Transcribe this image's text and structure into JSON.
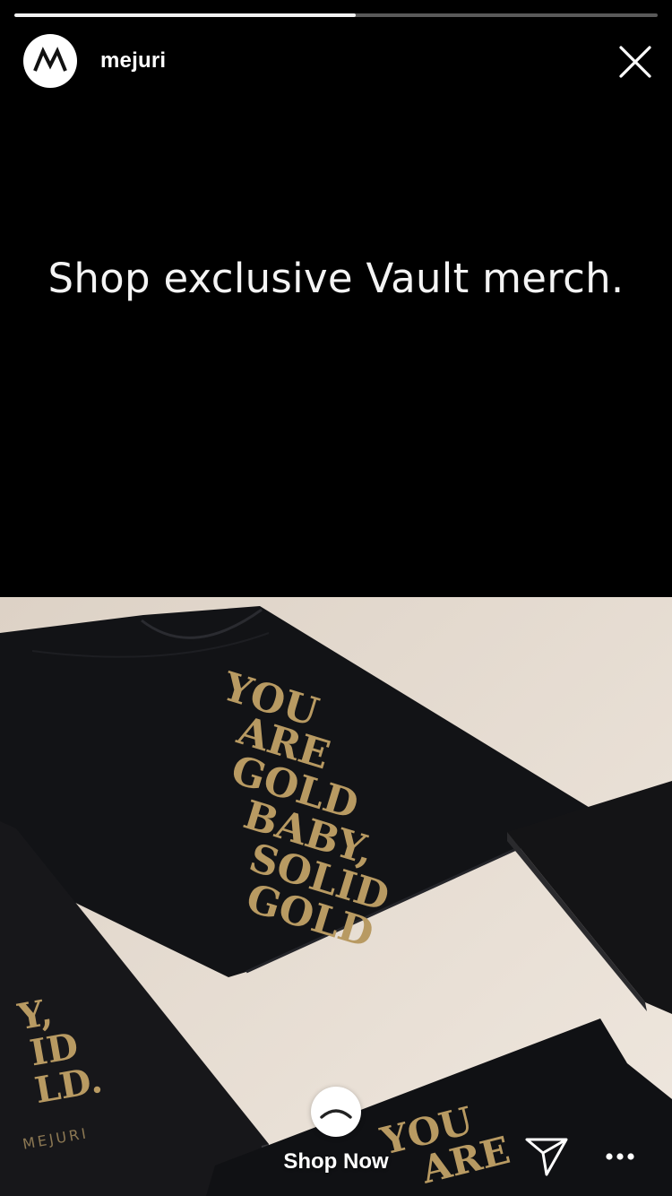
{
  "story": {
    "username": "mejuri",
    "progress": 0.53,
    "headline": "Shop exclusive Vault merch.",
    "image_text": {
      "shirt_lines": [
        "YOU",
        "ARE",
        "GOLD",
        "BABY,",
        "SOLID",
        "GOLD"
      ],
      "notebook_lines": [
        "Y,",
        "ID",
        "LD."
      ],
      "notebook_brand": "MEJURI",
      "bottom_shirt_lines": [
        "YOU",
        "ARE"
      ]
    }
  },
  "footer": {
    "shop_now_label": "Shop Now"
  },
  "icons": {
    "avatar": "mejuri-logo-icon",
    "close": "close-icon",
    "shop": "chevron-up-icon",
    "send": "send-icon",
    "more": "more-icon"
  },
  "colors": {
    "background": "#000000",
    "gold": "#b89a62",
    "surface": "#e6ddd2"
  }
}
